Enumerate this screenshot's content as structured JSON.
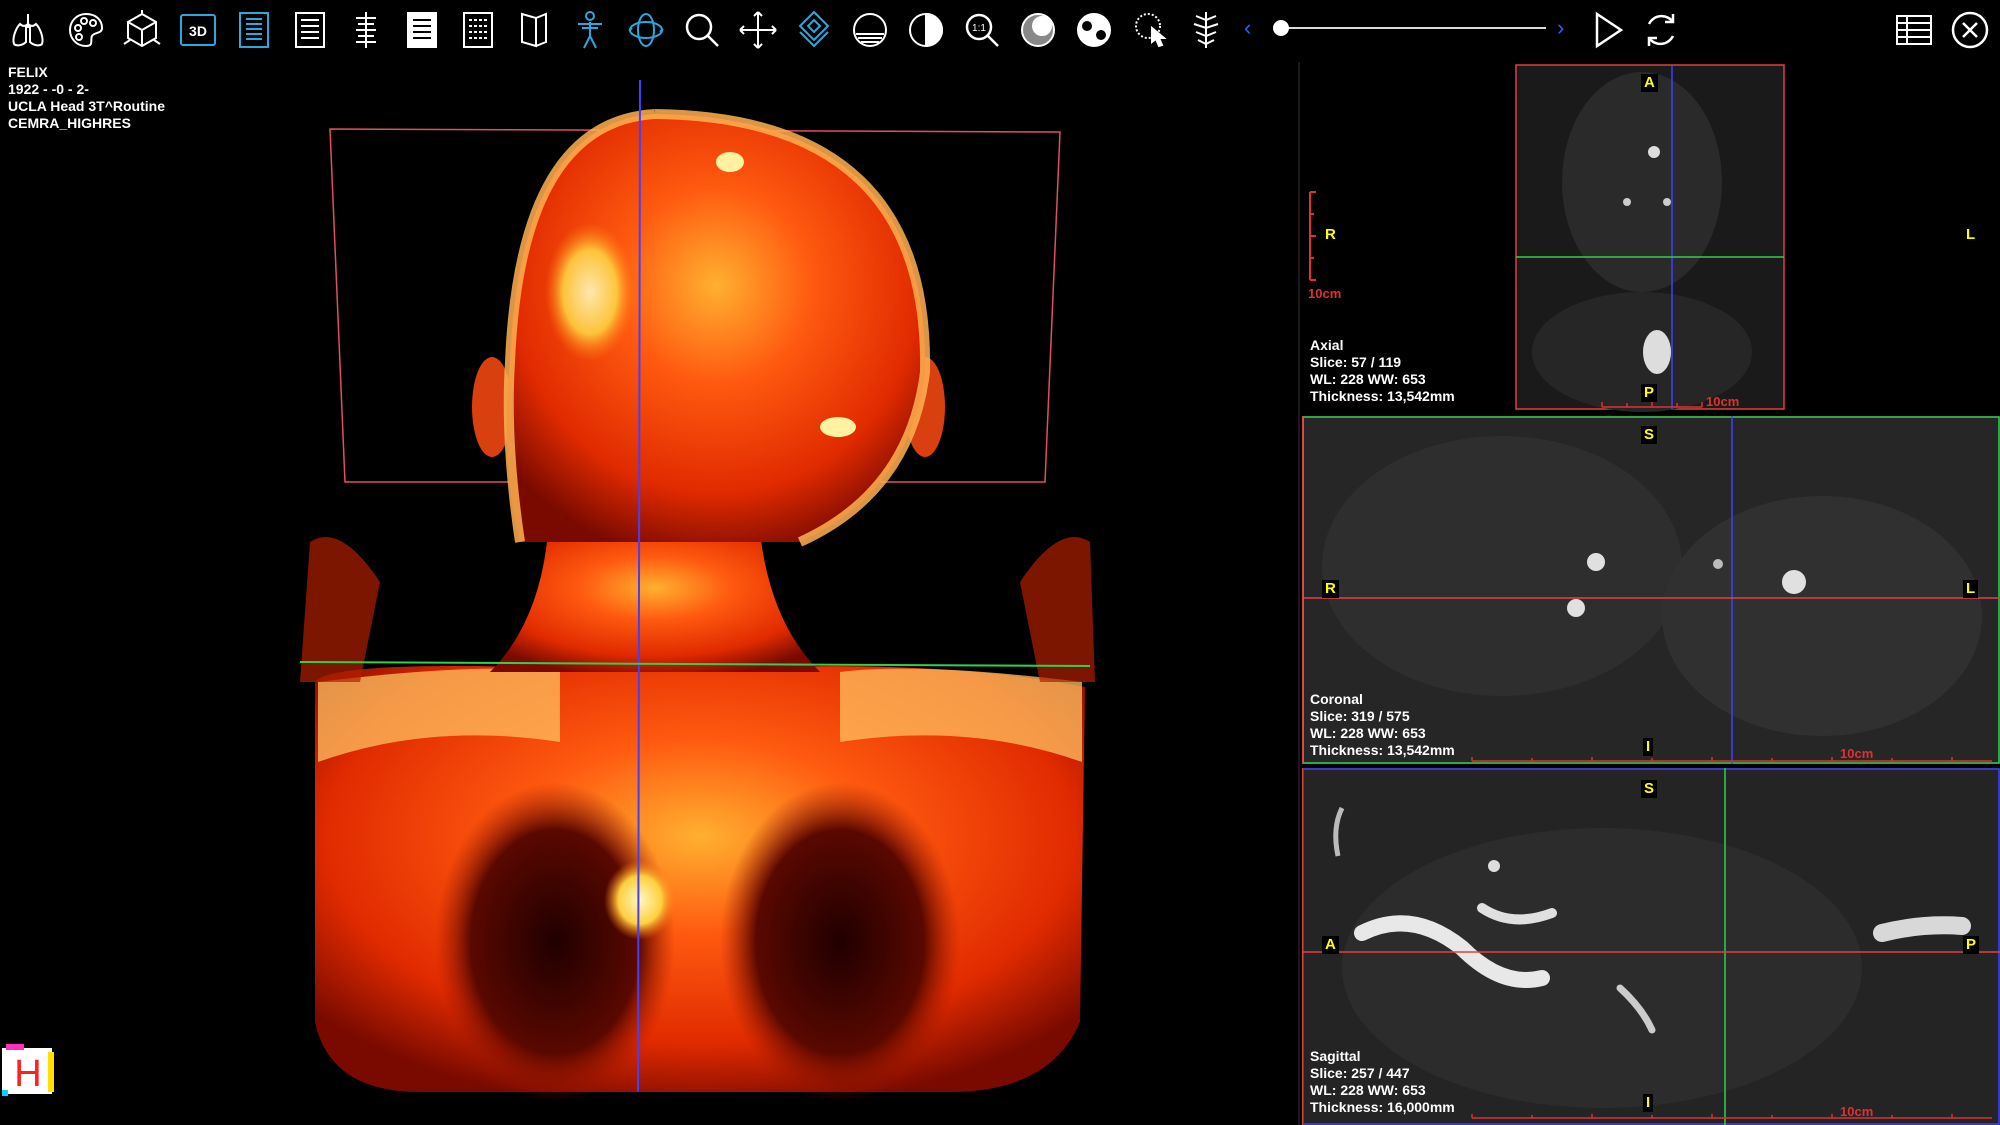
{
  "toolbar": {
    "tools": [
      {
        "icon": "lungs-icon"
      },
      {
        "icon": "palette-icon"
      },
      {
        "icon": "cube-icon"
      },
      {
        "icon": "3d-icon",
        "label": "3D"
      },
      {
        "icon": "mpr-layout-icon"
      },
      {
        "icon": "list-layout-icon"
      },
      {
        "icon": "spine-icon"
      },
      {
        "icon": "page-layout-icon"
      },
      {
        "icon": "grid-layout-icon"
      },
      {
        "icon": "book-icon"
      },
      {
        "icon": "body-icon"
      },
      {
        "icon": "rotate-3d-icon"
      },
      {
        "icon": "zoom-icon"
      },
      {
        "icon": "pan-icon"
      },
      {
        "icon": "layers-icon"
      },
      {
        "icon": "window-level-icon"
      },
      {
        "icon": "invert-icon"
      },
      {
        "icon": "zoom-1to1-icon",
        "label": "1:1"
      },
      {
        "icon": "contrast-icon"
      },
      {
        "icon": "yin-yang-icon"
      },
      {
        "icon": "touch-icon"
      },
      {
        "icon": "vertebrae-icon"
      }
    ],
    "active_color": "#2aa8e0",
    "slider_value": 0,
    "prev_label": "‹",
    "next_label": "›"
  },
  "viewport3d": {
    "patient_name": "FELIX",
    "patient_dob": "1922 - -0 - 2-",
    "study": "UCLA Head 3T^Routine",
    "series": "CEMRA_HIGHRES"
  },
  "axial": {
    "orientation_top": "A",
    "orientation_bottom": "P",
    "orientation_left": "R",
    "orientation_right": "L",
    "name": "Axial",
    "slice": "Slice: 57 / 119",
    "wlww": "WL: 228  WW: 653",
    "thickness": "Thickness: 13,542mm",
    "scale_left": "10cm",
    "scale_bottom": "10cm"
  },
  "coronal": {
    "orientation_top": "S",
    "orientation_bottom": "I",
    "orientation_left": "R",
    "orientation_right": "L",
    "name": "Coronal",
    "slice": "Slice: 319 / 575",
    "wlww": "WL: 228  WW: 653",
    "thickness": "Thickness: 13,542mm",
    "scale": "10cm"
  },
  "sagittal": {
    "orientation_top": "S",
    "orientation_bottom": "I",
    "orientation_left": "A",
    "orientation_right": "P",
    "name": "Sagittal",
    "slice": "Slice: 257 / 447",
    "wlww": "WL: 228  WW: 653",
    "thickness": "Thickness: 16,000mm",
    "scale": "10cm"
  },
  "logo": {
    "letter": "H"
  },
  "colors": {
    "crosshair_vertical": "#4040ff",
    "crosshair_horizontal_axial": "#30d050",
    "crosshair_red": "#e04040",
    "frame_red": "#e05060",
    "orientation_text": "#ffff00"
  }
}
